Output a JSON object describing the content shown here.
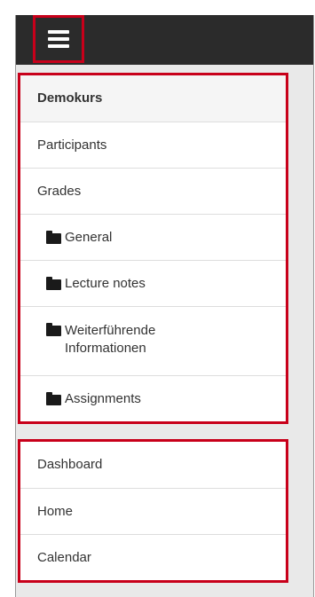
{
  "topbar": {
    "menu_icon": "hamburger-menu-icon"
  },
  "course_nav": {
    "header": "Demokurs",
    "items": [
      {
        "label": "Participants"
      },
      {
        "label": "Grades"
      }
    ],
    "folders": [
      {
        "label": "General",
        "icon": "folder-icon"
      },
      {
        "label": "Lecture notes",
        "icon": "folder-icon"
      },
      {
        "label": "Weiterführende Informationen",
        "icon": "folder-icon"
      },
      {
        "label": "Assignments",
        "icon": "folder-icon"
      }
    ]
  },
  "site_nav": {
    "items": [
      {
        "label": "Dashboard"
      },
      {
        "label": "Home"
      },
      {
        "label": "Calendar"
      }
    ]
  },
  "colors": {
    "highlight_border": "#c8001a",
    "topbar": "#2b2b2b",
    "background": "#e9e9e9"
  }
}
